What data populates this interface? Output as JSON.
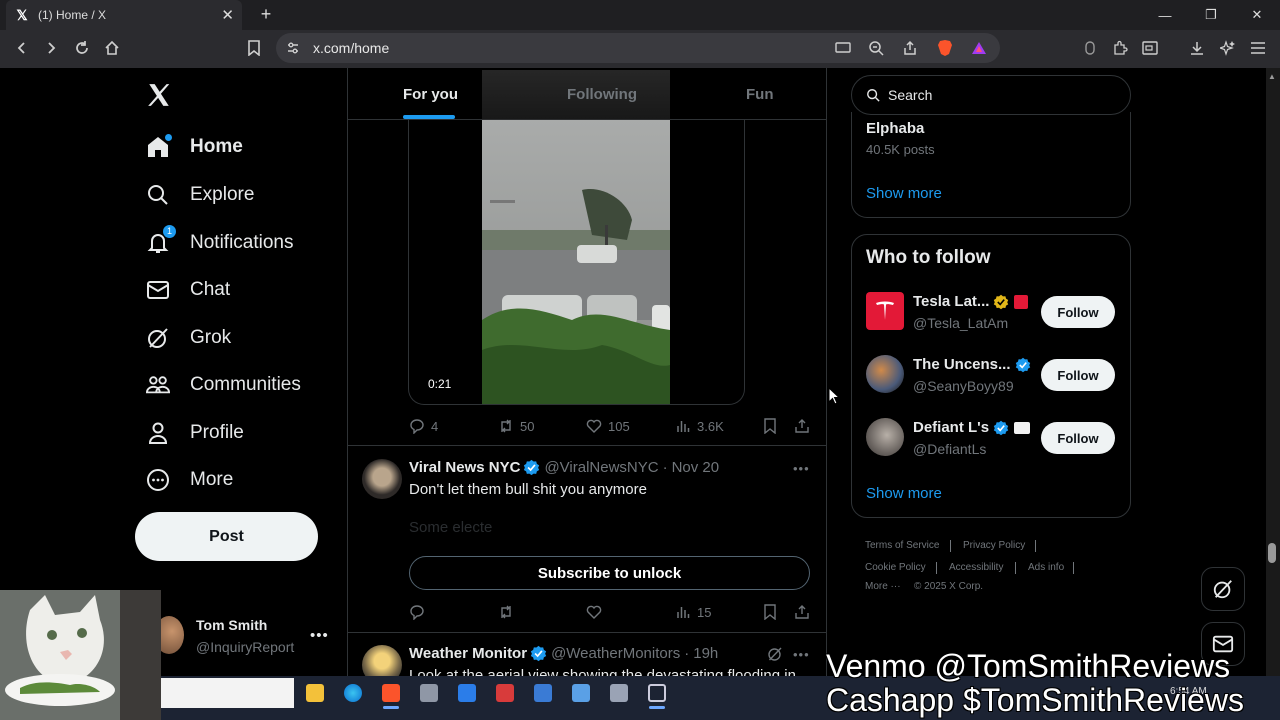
{
  "browser": {
    "tab_title": "(1) Home / X",
    "url": "x.com/home"
  },
  "nav": {
    "items": [
      {
        "label": "Home",
        "icon": "home-icon"
      },
      {
        "label": "Explore",
        "icon": "search-icon"
      },
      {
        "label": "Notifications",
        "icon": "bell-icon",
        "badge": "1"
      },
      {
        "label": "Chat",
        "icon": "mail-icon"
      },
      {
        "label": "Grok",
        "icon": "grok-icon"
      },
      {
        "label": "Communities",
        "icon": "people-icon"
      },
      {
        "label": "Profile",
        "icon": "person-icon"
      },
      {
        "label": "More",
        "icon": "more-circle-icon"
      }
    ],
    "post_label": "Post"
  },
  "account": {
    "name": "Tom Smith",
    "handle": "@InquiryReport"
  },
  "feed": {
    "tabs": [
      "For you",
      "Following",
      "Fun"
    ],
    "video_tweet": {
      "duration": "0:21",
      "replies": "4",
      "reposts": "50",
      "likes": "105",
      "views": "3.6K"
    },
    "tweet2": {
      "name": "Viral News NYC",
      "handle": "@ViralNewsNYC",
      "time": "Nov 20",
      "text": "Don't let them bull shit you anymore",
      "faded_text": "Some electe",
      "subscribe_label": "Subscribe to unlock",
      "views": "15"
    },
    "tweet3": {
      "name": "Weather Monitor",
      "handle": "@WeatherMonitors",
      "time": "19h",
      "text": "Look at the aerial view showing the devastating flooding in"
    }
  },
  "sidebar": {
    "search_placeholder": "Search",
    "trend": {
      "name": "Elphaba",
      "count": "40.5K posts"
    },
    "show_more": "Show more",
    "who_to_follow": {
      "title": "Who to follow",
      "follow_label": "Follow",
      "accounts": [
        {
          "name": "Tesla Lat...",
          "handle": "@Tesla_LatAm"
        },
        {
          "name": "The Uncens...",
          "handle": "@SeanyBoyy89"
        },
        {
          "name": "Defiant L's",
          "handle": "@DefiantLs"
        }
      ]
    },
    "footer": {
      "terms": "Terms of Service",
      "privacy": "Privacy Policy",
      "cookie": "Cookie Policy",
      "accessibility": "Accessibility",
      "ads": "Ads info",
      "more": "More ···",
      "copyright": "© 2025 X Corp."
    }
  },
  "taskbar": {
    "time": "6:54 AM"
  },
  "overlay": {
    "line1": "Venmo @TomSmithReviews",
    "line2": "Cashapp $TomSmithReviews"
  },
  "colors": {
    "accent": "#1d9bf0",
    "background": "#000000",
    "text": "#e7e9ea",
    "muted": "#71767b",
    "border": "#2f3336"
  }
}
